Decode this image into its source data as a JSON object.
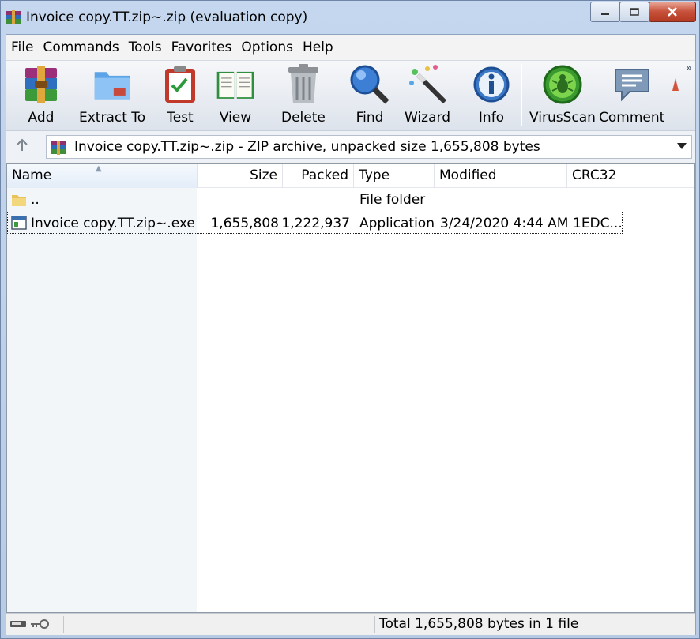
{
  "window": {
    "title": "Invoice copy.TT.zip~.zip (evaluation copy)",
    "minimize_icon": "minimize-icon",
    "maximize_icon": "maximize-icon",
    "close_icon": "close-icon"
  },
  "menu": [
    "File",
    "Commands",
    "Tools",
    "Favorites",
    "Options",
    "Help"
  ],
  "toolbar": {
    "add": "Add",
    "extract_to": "Extract To",
    "test": "Test",
    "view": "View",
    "delete": "Delete",
    "find": "Find",
    "wizard": "Wizard",
    "info": "Info",
    "virusscan": "VirusScan",
    "comment": "Comment",
    "overflow": "»"
  },
  "address": {
    "text": "Invoice copy.TT.zip~.zip - ZIP archive, unpacked size 1,655,808 bytes"
  },
  "columns": {
    "name": "Name",
    "size": "Size",
    "packed": "Packed",
    "type": "Type",
    "modified": "Modified",
    "crc32": "CRC32"
  },
  "rows": [
    {
      "name": "..",
      "size": "",
      "packed": "",
      "type": "File folder",
      "modified": "",
      "crc32": ""
    },
    {
      "name": "Invoice copy.TT.zip~.exe",
      "size": "1,655,808",
      "packed": "1,222,937",
      "type": "Application",
      "modified": "3/24/2020 4:44 AM",
      "crc32": "1EDC..."
    }
  ],
  "status": {
    "text": "Total 1,655,808 bytes in 1 file"
  },
  "colors": {
    "accent": "#3c78c8",
    "close_red": "#c7503a"
  }
}
